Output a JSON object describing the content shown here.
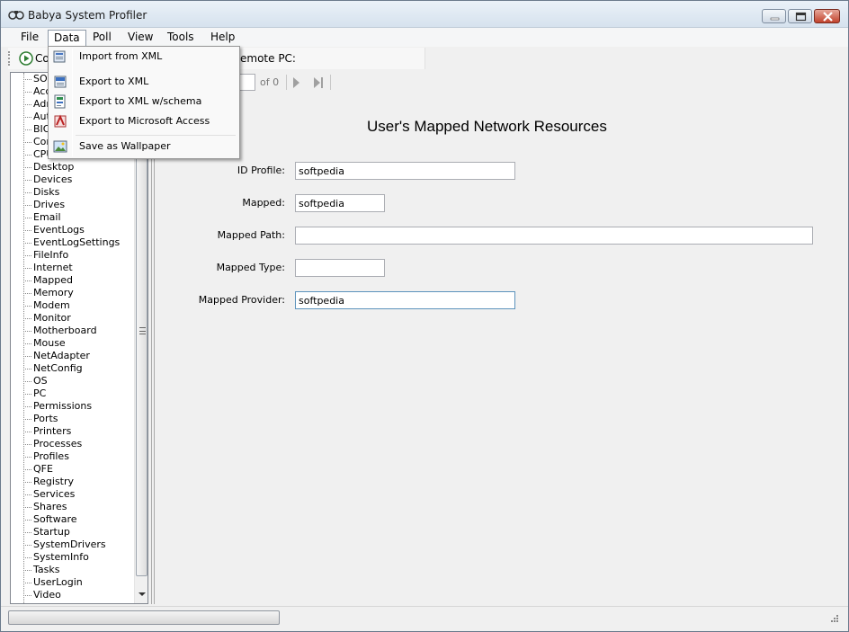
{
  "window": {
    "title": "Babya System Profiler"
  },
  "menubar": {
    "items": [
      "File",
      "Data",
      "Poll",
      "View",
      "Tools",
      "Help"
    ]
  },
  "toolbar": {
    "connect_label": "Co",
    "remote_label": "emote PC:"
  },
  "data_menu": {
    "items": [
      {
        "label": "Import from XML",
        "icon": "import-xml-icon"
      },
      {
        "label": "Export to XML",
        "icon": "export-xml-icon"
      },
      {
        "label": "Export to XML w/schema",
        "icon": "export-xml-schema-icon"
      },
      {
        "label": "Export to Microsoft Access",
        "icon": "access-icon"
      },
      {
        "label": "Save as Wallpaper",
        "icon": "wallpaper-icon"
      }
    ]
  },
  "tree": {
    "items": [
      "SO",
      "Acc",
      "Adr",
      "Aut",
      "BIO",
      "Cor",
      "CPU",
      "Desktop",
      "Devices",
      "Disks",
      "Drives",
      "Email",
      "EventLogs",
      "EventLogSettings",
      "FileInfo",
      "Internet",
      "Mapped",
      "Memory",
      "Modem",
      "Monitor",
      "Motherboard",
      "Mouse",
      "NetAdapter",
      "NetConfig",
      "OS",
      "PC",
      "Permissions",
      "Ports",
      "Printers",
      "Processes",
      "Profiles",
      "QFE",
      "Registry",
      "Services",
      "Shares",
      "Software",
      "Startup",
      "SystemDrivers",
      "SystemInfo",
      "Tasks",
      "UserLogin",
      "Video"
    ]
  },
  "navigator": {
    "of_text": "of 0"
  },
  "form": {
    "title": "User's Mapped Network Resources",
    "fields": [
      {
        "label": "ID Profile:",
        "value": "softpedia"
      },
      {
        "label": "Mapped:",
        "value": "softpedia"
      },
      {
        "label": "Mapped Path:",
        "value": ""
      },
      {
        "label": "Mapped Type:",
        "value": ""
      },
      {
        "label": "Mapped Provider:",
        "value": "softpedia"
      }
    ]
  }
}
